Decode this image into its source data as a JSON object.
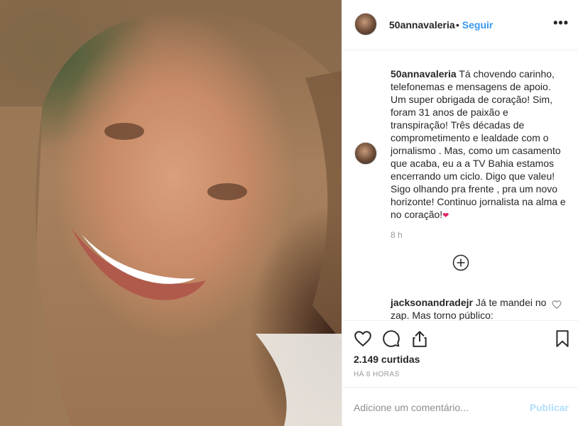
{
  "post": {
    "username": "50annavaleria",
    "follow_label": "Seguir",
    "more_label": "•••",
    "caption_user": "50annavaleria",
    "caption_text": "Tá chovendo carinho, telefonemas e mensagens de apoio. Um super obrigada de coração! Sim, foram 31 anos de paixão e transpiração! Três décadas de comprometimento e lealdade com o jornalismo . Mas, como um casamento que acaba, eu a a TV Bahia estamos encerrando um ciclo. Digo que valeu! Sigo olhando pra frente , pra um novo horizonte! Continuo jornalista na alma e no coração!",
    "caption_emoji": "❤",
    "caption_time": "8 h",
    "reply_user": "jacksonandradejr",
    "reply_text": "Já te mandei no zap. Mas torno público:",
    "likes": "2.149 curtidas",
    "posted_ago": "HÁ 8 HORAS",
    "comment_placeholder": "Adicione um comentário...",
    "publish_label": "Publicar"
  }
}
